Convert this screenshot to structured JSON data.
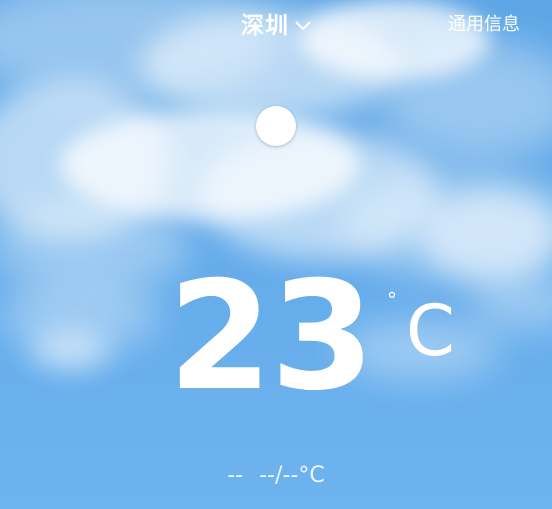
{
  "header": {
    "city": "深圳",
    "general_info": "通用信息"
  },
  "weather": {
    "temperature": "23",
    "degree_symbol": "°",
    "unit": "C",
    "condition": "--",
    "range": "--/--°C"
  },
  "colors": {
    "sky_top": "#5ea6e6",
    "sky_bottom": "#6db3ef",
    "text": "#ffffff"
  },
  "icons": {
    "city_dropdown": "chevron-down-icon"
  }
}
